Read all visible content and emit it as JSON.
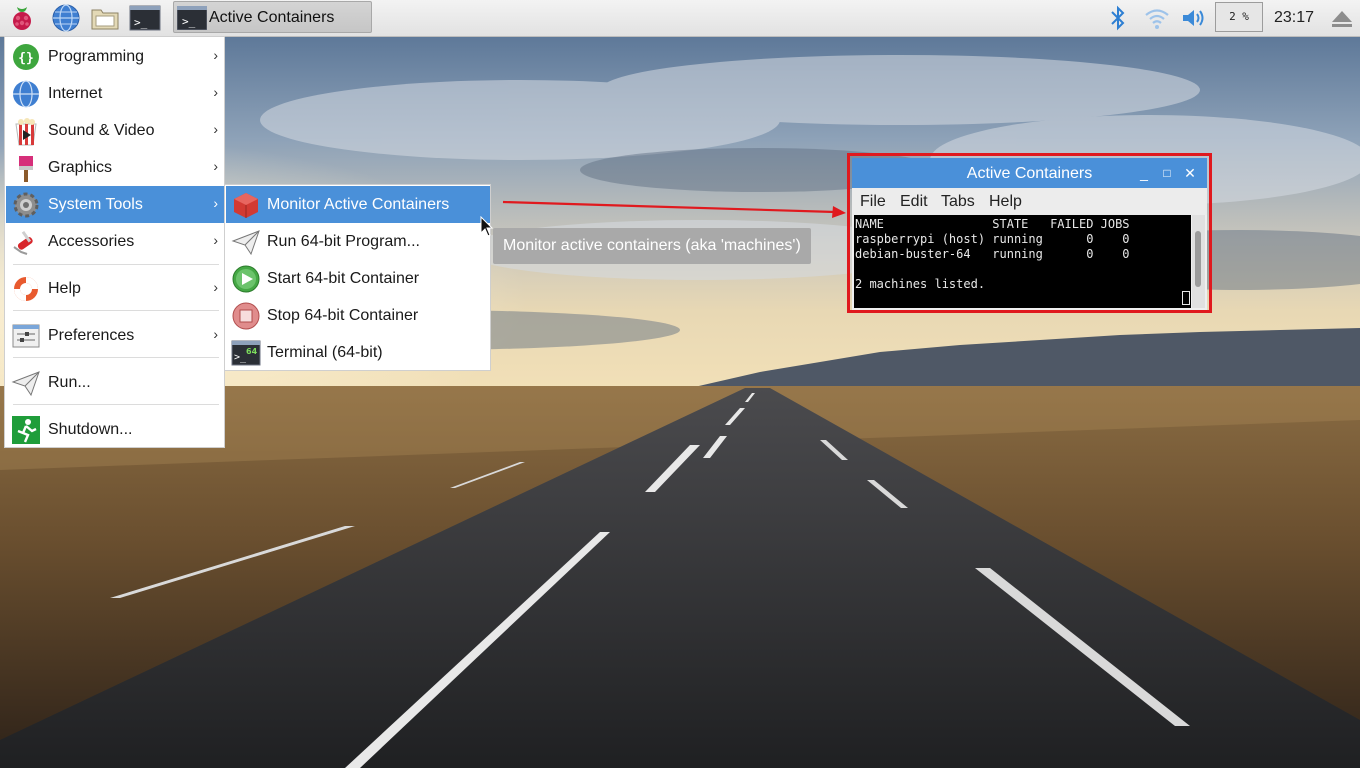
{
  "panel": {
    "launchers": [
      {
        "name": "raspberry-menu-icon"
      },
      {
        "name": "web-browser-icon"
      },
      {
        "name": "file-manager-icon"
      },
      {
        "name": "terminal-icon"
      }
    ],
    "taskbar_button": {
      "label": "Active Containers",
      "icon": "terminal-icon"
    },
    "tray": {
      "cpu_label": "2 %",
      "clock": "23:17"
    }
  },
  "menu": {
    "items": [
      {
        "label": "Programming",
        "icon": "programming-icon",
        "submenu": true
      },
      {
        "label": "Internet",
        "icon": "globe-icon",
        "submenu": true
      },
      {
        "label": "Sound & Video",
        "icon": "popcorn-icon",
        "submenu": true
      },
      {
        "label": "Graphics",
        "icon": "paintbrush-icon",
        "submenu": true
      },
      {
        "label": "System Tools",
        "icon": "gear-icon",
        "submenu": true,
        "selected": true
      },
      {
        "label": "Accessories",
        "icon": "knife-icon",
        "submenu": true
      },
      {
        "label": "Help",
        "icon": "lifebuoy-icon",
        "submenu": true
      },
      {
        "label": "Preferences",
        "icon": "preferences-icon",
        "submenu": true
      },
      {
        "label": "Run...",
        "icon": "paper-plane-icon",
        "submenu": false
      },
      {
        "label": "Shutdown...",
        "icon": "exit-icon",
        "submenu": false
      }
    ],
    "arrow_glyph": "›"
  },
  "submenu": {
    "items": [
      {
        "label": "Monitor Active Containers",
        "icon": "container-box-icon",
        "selected": true
      },
      {
        "label": "Run 64-bit Program...",
        "icon": "paper-plane-icon"
      },
      {
        "label": "Start 64-bit Container",
        "icon": "play-icon"
      },
      {
        "label": "Stop 64-bit Container",
        "icon": "stop-icon"
      },
      {
        "label": "Terminal (64-bit)",
        "icon": "terminal-64-icon"
      }
    ]
  },
  "tooltip": {
    "text": "Monitor active containers (aka 'machines')"
  },
  "window": {
    "title": "Active Containers",
    "buttons": {
      "minimize": "_",
      "maximize": "□",
      "close": "✕"
    },
    "menubar": [
      "File",
      "Edit",
      "Tabs",
      "Help"
    ],
    "terminal": {
      "header": "NAME               STATE   FAILED JOBS",
      "rows": [
        "raspberrypi (host) running      0    0",
        "debian-buster-64   running      0    0"
      ],
      "footer": "2 machines listed."
    }
  },
  "colors": {
    "accent": "#4a90d9",
    "highlight_box": "#e0191e",
    "tooltip_bg": "#a9a9a9"
  }
}
